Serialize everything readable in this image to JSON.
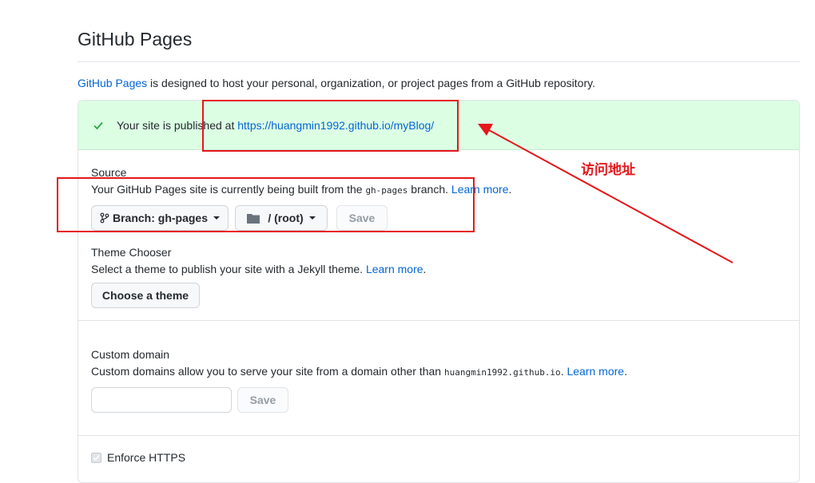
{
  "page": {
    "title": "GitHub Pages",
    "intro_link": "GitHub Pages",
    "intro_text": " is designed to host your personal, organization, or project pages from a GitHub repository."
  },
  "flash": {
    "text": "Your site is published at ",
    "url": "https://huangmin1992.github.io/myBlog/",
    "icon": "check-icon",
    "color": "#dcffe4"
  },
  "source": {
    "title": "Source",
    "desc_before": "Your GitHub Pages site is currently being built from the ",
    "branch_code": "gh-pages",
    "desc_after": " branch. ",
    "learn_more": "Learn more",
    "desc_end": ".",
    "branch_button": "Branch: gh-pages",
    "folder_button": "/ (root)",
    "save_button": "Save"
  },
  "theme": {
    "title": "Theme Chooser",
    "desc": "Select a theme to publish your site with a Jekyll theme. ",
    "learn_more": "Learn more",
    "desc_end": ".",
    "button": "Choose a theme"
  },
  "domain": {
    "title": "Custom domain",
    "desc_before": "Custom domains allow you to serve your site from a domain other than ",
    "domain_code": "huangmin1992.github.io",
    "desc_after": ". ",
    "learn_more": "Learn more",
    "desc_end": ".",
    "input_value": "",
    "save_button": "Save"
  },
  "https": {
    "label": "Enforce HTTPS",
    "checked": true
  },
  "annotation": {
    "label": "访问地址",
    "color": "#e5171b"
  }
}
